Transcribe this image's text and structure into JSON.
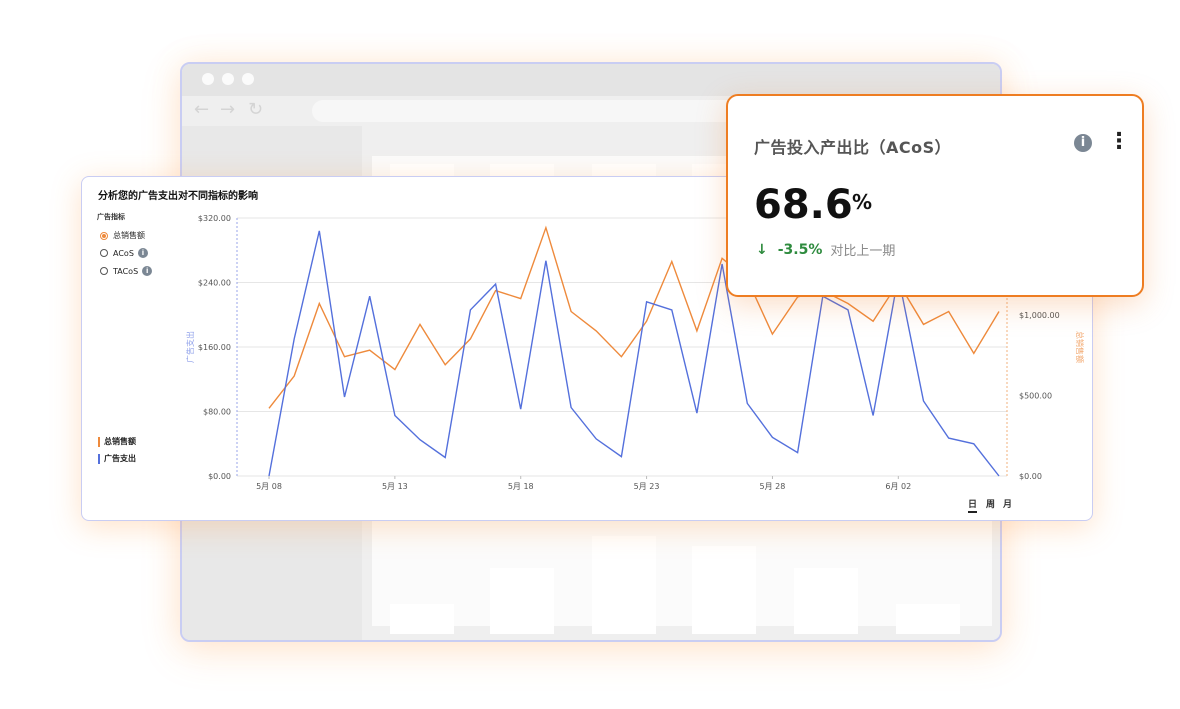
{
  "panel": {
    "title": "分析您的广告支出对不同指标的影响",
    "metric_label": "广告指标",
    "metrics": [
      {
        "label": "总销售额",
        "selected": true,
        "info": false
      },
      {
        "label": "ACoS",
        "selected": false,
        "info": true
      },
      {
        "label": "TACoS",
        "selected": false,
        "info": true
      }
    ],
    "legend": [
      {
        "label": "总销售额",
        "color": "#ee8a3c"
      },
      {
        "label": "广告支出",
        "color": "#5470dc"
      }
    ],
    "periods": [
      "日",
      "周",
      "月"
    ],
    "active_period": "日"
  },
  "chart_data": {
    "type": "line",
    "x_start": "5月 08",
    "x_tick_labels": [
      "5月 08",
      "5月 13",
      "5月 18",
      "5月 23",
      "5月 28",
      "6月 02"
    ],
    "y_left": {
      "label": "广告支出",
      "ticks": [
        "$0.00",
        "$80.00",
        "$160.00",
        "$240.00",
        "$320.00"
      ],
      "range": [
        0,
        320
      ]
    },
    "y_right": {
      "label": "总销售额",
      "ticks": [
        "$0.00",
        "$500.00",
        "$1,000.00"
      ],
      "range": [
        0,
        1600
      ]
    },
    "series": [
      {
        "name": "广告支出",
        "axis": "left",
        "color": "#5470dc",
        "values": [
          0,
          170,
          304,
          98,
          223,
          75,
          45,
          23,
          206,
          238,
          83,
          267,
          85,
          46,
          24,
          216,
          206,
          78,
          263,
          90,
          48,
          29,
          223,
          206,
          75,
          248,
          93,
          47,
          40,
          0
        ]
      },
      {
        "name": "总销售额",
        "axis": "right",
        "color": "#ee8a3c",
        "values": [
          420,
          620,
          1070,
          740,
          780,
          660,
          940,
          690,
          850,
          1150,
          1100,
          1540,
          1020,
          900,
          740,
          960,
          1330,
          900,
          1350,
          1220,
          880,
          1110,
          1150,
          1070,
          960,
          1200,
          940,
          1020,
          760,
          1020
        ]
      }
    ]
  },
  "acos_card": {
    "title": "广告投入产出比（ACoS）",
    "info_icon": "i",
    "menu_icon": "⋮",
    "value": "68.6",
    "unit": "%",
    "arrow": "↓",
    "change": "-3.5%",
    "compare_text": "对比上一期",
    "change_color": "#2e8b3e"
  }
}
